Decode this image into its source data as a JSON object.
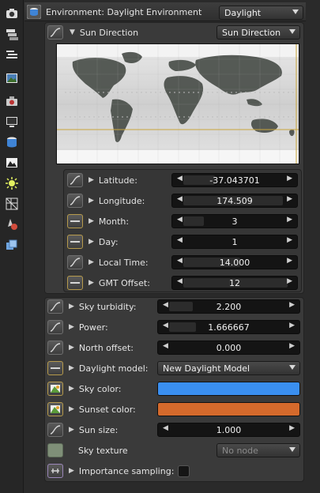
{
  "colors": {
    "sky": "#3a8ff0",
    "sunset": "#d56a2c",
    "gold": "#c9a53a"
  },
  "toolbar": {
    "icons": [
      "camera-settings-icon",
      "layers-icon",
      "align-icon",
      "image-icon",
      "camera-icon",
      "monitor-icon",
      "environment-icon",
      "photo-icon",
      "light-icon",
      "grid-texture-icon",
      "material-icon",
      "cubes-icon"
    ]
  },
  "header": {
    "title": "Environment: Daylight Environment",
    "preset_value": "Daylight"
  },
  "sun_direction": {
    "label": "Sun Direction",
    "dropdown_value": "Sun Direction",
    "latitude": {
      "label": "Latitude:",
      "value": "-37.043701"
    },
    "longitude": {
      "label": "Longitude:",
      "value": "174.509"
    },
    "month": {
      "label": "Month:",
      "value": "3"
    },
    "day": {
      "label": "Day:",
      "value": "1"
    },
    "local_time": {
      "label": "Local Time:",
      "value": "14.000"
    },
    "gmt_offset": {
      "label": "GMT Offset:",
      "value": "12"
    }
  },
  "params": {
    "sky_turbidity": {
      "label": "Sky turbidity:",
      "value": "2.200"
    },
    "power": {
      "label": "Power:",
      "value": "1.666667"
    },
    "north_offset": {
      "label": "North offset:",
      "value": "0.000"
    },
    "daylight_model": {
      "label": "Daylight model:",
      "value": "New Daylight Model"
    },
    "sky_color": {
      "label": "Sky color:"
    },
    "sunset_color": {
      "label": "Sunset color:"
    },
    "sun_size": {
      "label": "Sun size:",
      "value": "1.000"
    },
    "sky_texture": {
      "label": "Sky texture",
      "value": "No node"
    },
    "importance_sampling": {
      "label": "Importance sampling:",
      "checked": false
    }
  }
}
